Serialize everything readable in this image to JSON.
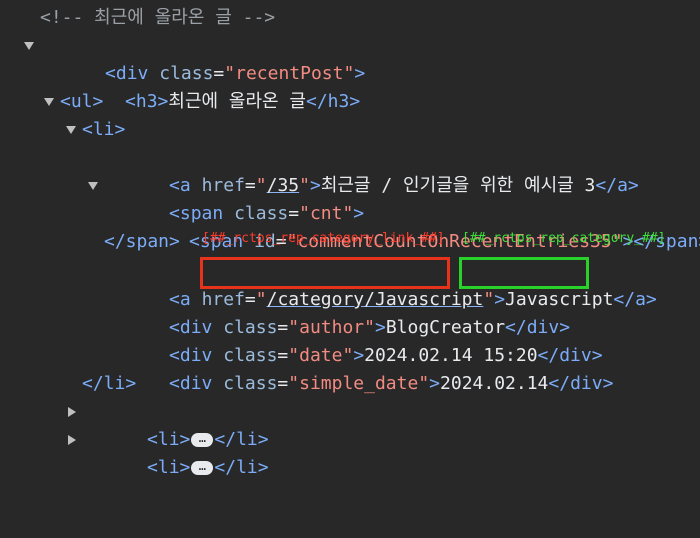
{
  "comment_line": "<!-- 최근에 올라온 글 -->",
  "div_recent": {
    "tag": "div",
    "attr": "class",
    "value": "recentPost"
  },
  "h3": {
    "open": "<h3>",
    "text": "최근에 올라온 글",
    "close": "</h3>"
  },
  "ul": "<ul>",
  "li_open": "<li>",
  "a_post": {
    "href": "/35",
    "text": "최근글 / 인기글을 위한 예시글 3"
  },
  "span_cnt": {
    "attr": "class",
    "value": "cnt"
  },
  "span_inner": {
    "attr": "id",
    "value": "commentCountOnRecentEntries35"
  },
  "span_close": "</span>",
  "annotations": {
    "red_label": "[##_rctps_rep_category_link_##]",
    "green_label": "[##_rctps_rep_category_##]"
  },
  "a_category": {
    "href": "/category/Javascript",
    "text": "Javascript"
  },
  "div_author": {
    "value": "author",
    "text": "BlogCreator"
  },
  "div_date": {
    "value": "date",
    "text": "2024.02.14 15:20"
  },
  "div_simple_date": {
    "value": "simple_date",
    "text": "2024.02.14"
  },
  "li_close": "</li>",
  "collapsed_li": {
    "open": "<li>",
    "close": "</li>"
  },
  "colors": {
    "red_box": "#e8331c",
    "green_box": "#29d12b",
    "background": "#282828"
  }
}
